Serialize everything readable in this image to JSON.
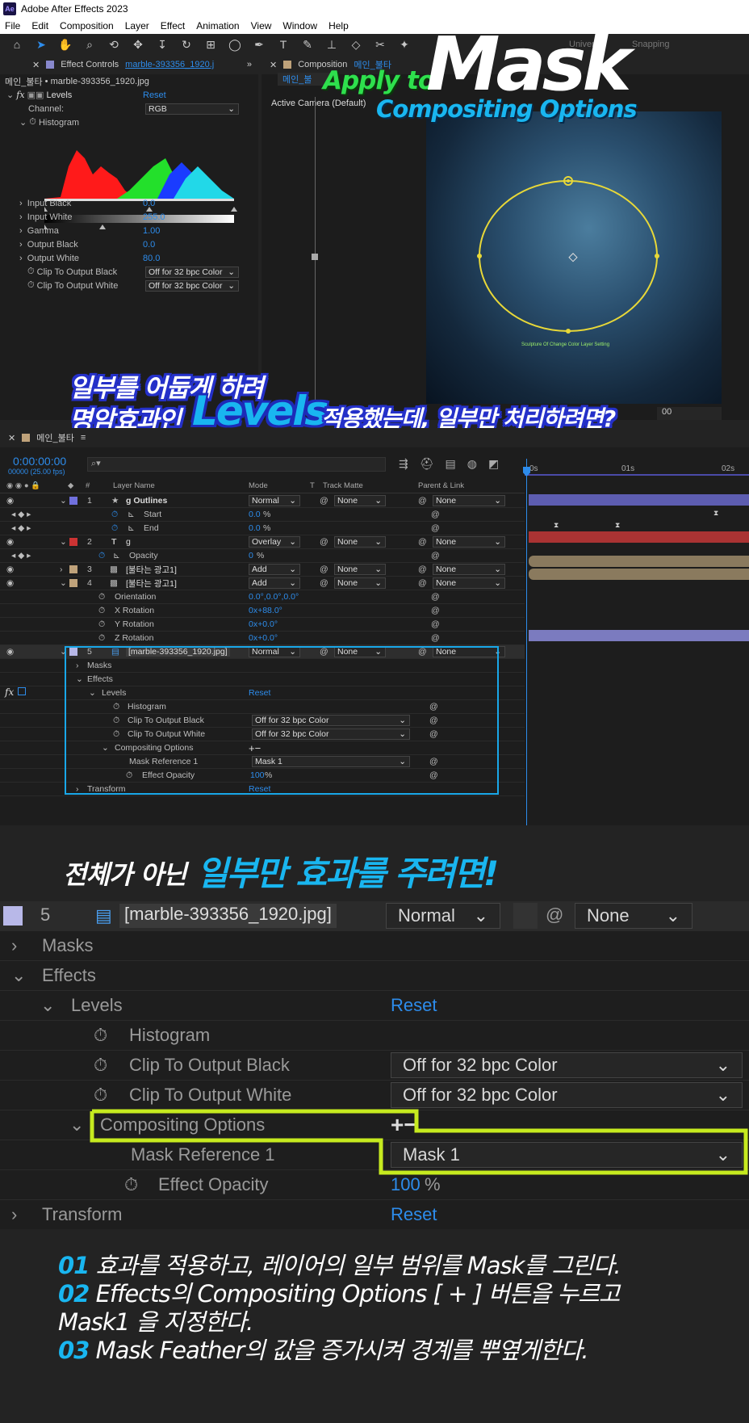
{
  "app_title": "Adobe After Effects 2023",
  "app_logo": "Ae",
  "menu": [
    "File",
    "Edit",
    "Composition",
    "Layer",
    "Effect",
    "Animation",
    "View",
    "Window",
    "Help"
  ],
  "toolbar": {
    "universal": "Universal",
    "snapping": "Snapping"
  },
  "effect_controls": {
    "tab": "Effect Controls",
    "file": "marble-393356_1920.j",
    "breadcrumb_comp": "메인_불타",
    "breadcrumb_file": "marble-393356_1920.jpg",
    "effect_name": "Levels",
    "reset": "Reset",
    "channel_label": "Channel:",
    "channel_value": "RGB",
    "histogram": "Histogram",
    "params": [
      {
        "label": "Input Black",
        "value": "0.0"
      },
      {
        "label": "Input White",
        "value": "255.0"
      },
      {
        "label": "Gamma",
        "value": "1.00"
      },
      {
        "label": "Output Black",
        "value": "0.0"
      },
      {
        "label": "Output White",
        "value": "80.0"
      }
    ],
    "clip_black": "Clip To Output Black",
    "clip_white": "Clip To Output White",
    "clip_value": "Off for 32 bpc Color"
  },
  "composition": {
    "tab": "Composition",
    "comp_name": "메인_불타",
    "sub_tab": "메인_불",
    "camera": "Active Camera (Default)",
    "canvas_caption": "Sculpture Of Change Color Layer Setting",
    "zoom_stub": "00"
  },
  "headline": {
    "apply_to": "Apply to",
    "mask": "Mask",
    "sub": "Compositing Options"
  },
  "overlay1": {
    "line1": "일부를 어둡게 하려",
    "line2a": "명암효과인",
    "levels": "Levels",
    "line2b": "적용했는데, 일부만 처리하려면?"
  },
  "timeline": {
    "comp_tab": "메인_불타",
    "timecode": "0:00:00:00",
    "frames": "00000 (25.00 fps)",
    "search_placeholder": "",
    "cols": {
      "num": "#",
      "layer": "Layer Name",
      "mode": "Mode",
      "t": "T",
      "matte": "Track Matte",
      "parent": "Parent & Link"
    },
    "ruler": [
      "0s",
      "01s",
      "02s"
    ],
    "rows": [
      {
        "num": "1",
        "name": "g Outlines",
        "mode": "Normal",
        "matte": "None",
        "parent": "None"
      },
      {
        "name": "Start",
        "value": "0.0",
        "unit": "%"
      },
      {
        "name": "End",
        "value": "0.0",
        "unit": "%"
      },
      {
        "num": "2",
        "name": "g",
        "mode": "Overlay",
        "matte": "None",
        "parent": "None"
      },
      {
        "name": "Opacity",
        "value": "0",
        "unit": "%"
      },
      {
        "num": "3",
        "name": "[불타는 광고1]",
        "mode": "Add",
        "matte": "None",
        "parent": "None"
      },
      {
        "num": "4",
        "name": "[불타는 광고1]",
        "mode": "Add",
        "matte": "None",
        "parent": "None"
      },
      {
        "name": "Orientation",
        "value": "0.0°,0.0°,0.0°"
      },
      {
        "name": "X Rotation",
        "value": "0x+88.0°"
      },
      {
        "name": "Y Rotation",
        "value": "0x+0.0°"
      },
      {
        "name": "Z Rotation",
        "value": "0x+0.0°"
      },
      {
        "num": "5",
        "name": "[marble-393356_1920.jpg]",
        "mode": "Normal",
        "matte": "None",
        "parent": "None"
      }
    ],
    "sub": {
      "masks": "Masks",
      "effects": "Effects",
      "levels": "Levels",
      "reset": "Reset",
      "histogram": "Histogram",
      "clip_black": "Clip To Output Black",
      "clip_white": "Clip To Output White",
      "clip_value": "Off for 32 bpc Color",
      "compositing": "Compositing Options",
      "plusminus": "+−",
      "mask_ref": "Mask Reference 1",
      "mask_value": "Mask 1",
      "opacity": "Effect Opacity",
      "opacity_value": "100",
      "opacity_unit": "%",
      "transform": "Transform",
      "fx": "fx"
    }
  },
  "overlay2": {
    "part1": "전체가 아닌",
    "part2": "일부만 효과를 주려면!"
  },
  "zoom": {
    "num": "5",
    "name": "[marble-393356_1920.jpg]",
    "mode": "Normal",
    "parent": "None",
    "masks": "Masks",
    "effects": "Effects",
    "levels": "Levels",
    "reset": "Reset",
    "histogram": "Histogram",
    "clip_black": "Clip To Output Black",
    "clip_white": "Clip To Output White",
    "clip_value": "Off for 32 bpc Color",
    "compositing": "Compositing Options",
    "plusminus": "+−",
    "mask_ref": "Mask Reference 1",
    "mask_value": "Mask 1",
    "opacity": "Effect Opacity",
    "opacity_value": "100",
    "opacity_unit": "%",
    "transform": "Transform"
  },
  "steps": [
    {
      "n": "01",
      "text": " 효과를 적용하고, 레이어의 일부 범위를 Mask를 그린다."
    },
    {
      "n": "02",
      "text": "  Effects의 Compositing Options  [ + ] 버튼을 누르고"
    },
    {
      "n": "",
      "text": "Mask1 을 지정한다."
    },
    {
      "n": "03",
      "text": "  Mask Feather의 값을 증가시켜 경계를  뿌옆게한다."
    }
  ],
  "colors": {
    "accent": "#2d8ceb",
    "highlight": "#c6ea1f",
    "cyan": "#19b6f0",
    "green": "#2ee04d"
  }
}
